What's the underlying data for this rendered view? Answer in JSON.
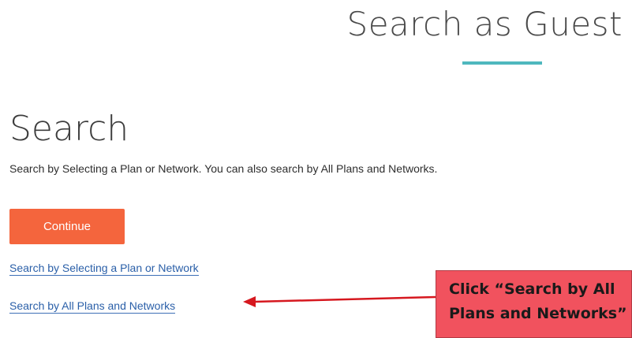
{
  "page": {
    "title": "Search as Guest"
  },
  "search": {
    "heading": "Search",
    "instructions": "Search by Selecting a Plan or Network. You can also search by All Plans and Networks.",
    "continue_label": "Continue",
    "link_plan": "Search by Selecting a Plan or Network",
    "link_all": "Search by All Plans and Networks"
  },
  "annotation": {
    "line1": "Click “Search by All",
    "line2": "Plans and Networks”"
  },
  "colors": {
    "accent_teal": "#4fb8be",
    "button": "#f4653d",
    "link": "#2a5fa8",
    "callout_bg": "#f1525e",
    "arrow": "#d6181f"
  }
}
